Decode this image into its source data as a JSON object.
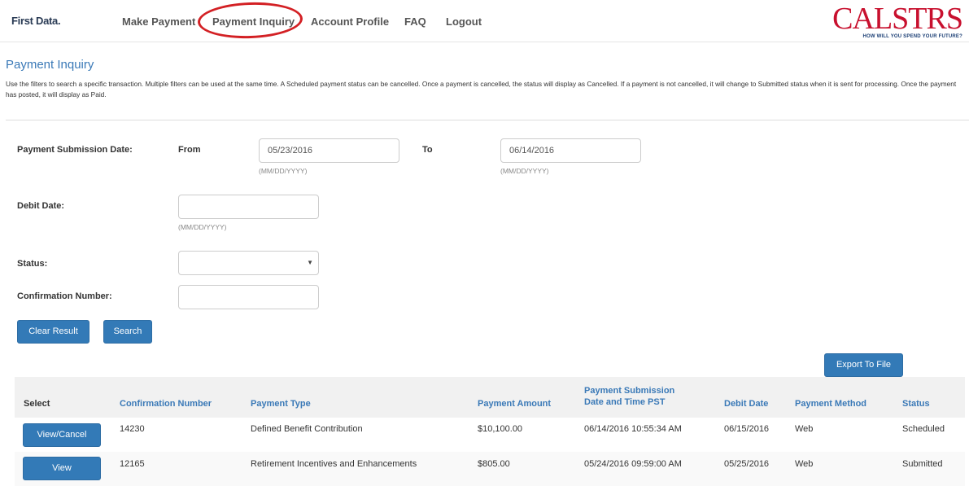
{
  "brand": {
    "left_logo": "First Data.",
    "right_logo": "CALSTRS",
    "right_tagline": "HOW WILL YOU SPEND YOUR FUTURE?",
    "accent": "#337ab7",
    "highlight": "#d32024"
  },
  "nav": {
    "make_payment": "Make Payment",
    "payment_inquiry": "Payment Inquiry",
    "account_profile": "Account Profile",
    "faq": "FAQ",
    "logout": "Logout"
  },
  "page": {
    "title": "Payment Inquiry",
    "intro": "Use the filters to search a specific transaction. Multiple filters can be used at the same time. A Scheduled payment status can be cancelled. Once a payment is cancelled, the status will display as Cancelled. If a payment is not cancelled, it will change to Submitted status when it is sent for processing. Once the payment has posted, it will display as Paid."
  },
  "filters": {
    "submission_label": "Payment Submission Date:",
    "from_label": "From",
    "from_value": "05/23/2016",
    "to_label": "To",
    "to_value": "06/14/2016",
    "date_hint": "(MM/DD/YYYY)",
    "debit_label": "Debit Date:",
    "debit_value": "",
    "status_label": "Status:",
    "status_value": "",
    "confirmation_label": "Confirmation Number:",
    "confirmation_value": "",
    "clear_button": "Clear Result",
    "search_button": "Search"
  },
  "export_button": "Export To File",
  "table": {
    "headers": {
      "select": "Select",
      "confirmation": "Confirmation Number",
      "type": "Payment Type",
      "amount": "Payment Amount",
      "submission_line1": "Payment Submission",
      "submission_line2": "Date and Time PST",
      "debit": "Debit Date",
      "method": "Payment Method",
      "status": "Status"
    },
    "rows": [
      {
        "action": "View/Cancel",
        "confirmation": "14230",
        "type": "Defined Benefit Contribution",
        "amount": "$10,100.00",
        "submitted": "06/14/2016 10:55:34 AM",
        "debit": "06/15/2016",
        "method": "Web",
        "status": "Scheduled"
      },
      {
        "action": "View",
        "confirmation": "12165",
        "type": "Retirement Incentives and Enhancements",
        "amount": "$805.00",
        "submitted": "05/24/2016 09:59:00 AM",
        "debit": "05/25/2016",
        "method": "Web",
        "status": "Submitted"
      }
    ]
  }
}
